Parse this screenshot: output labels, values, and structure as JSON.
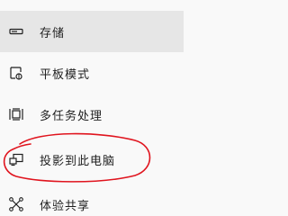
{
  "nav": {
    "items": [
      {
        "label": "存储",
        "icon": "storage-icon",
        "selected": true
      },
      {
        "label": "平板模式",
        "icon": "tablet-mode-icon",
        "selected": false
      },
      {
        "label": "多任务处理",
        "icon": "multitasking-icon",
        "selected": false
      },
      {
        "label": "投影到此电脑",
        "icon": "projecting-to-pc-icon",
        "selected": false
      },
      {
        "label": "体验共享",
        "icon": "shared-experiences-icon",
        "selected": false
      }
    ]
  },
  "colors": {
    "text": "#1f1f1f",
    "selected_bg": "#e6e6e6",
    "background": "#f9f9f9",
    "annotation": "#e0141e"
  }
}
